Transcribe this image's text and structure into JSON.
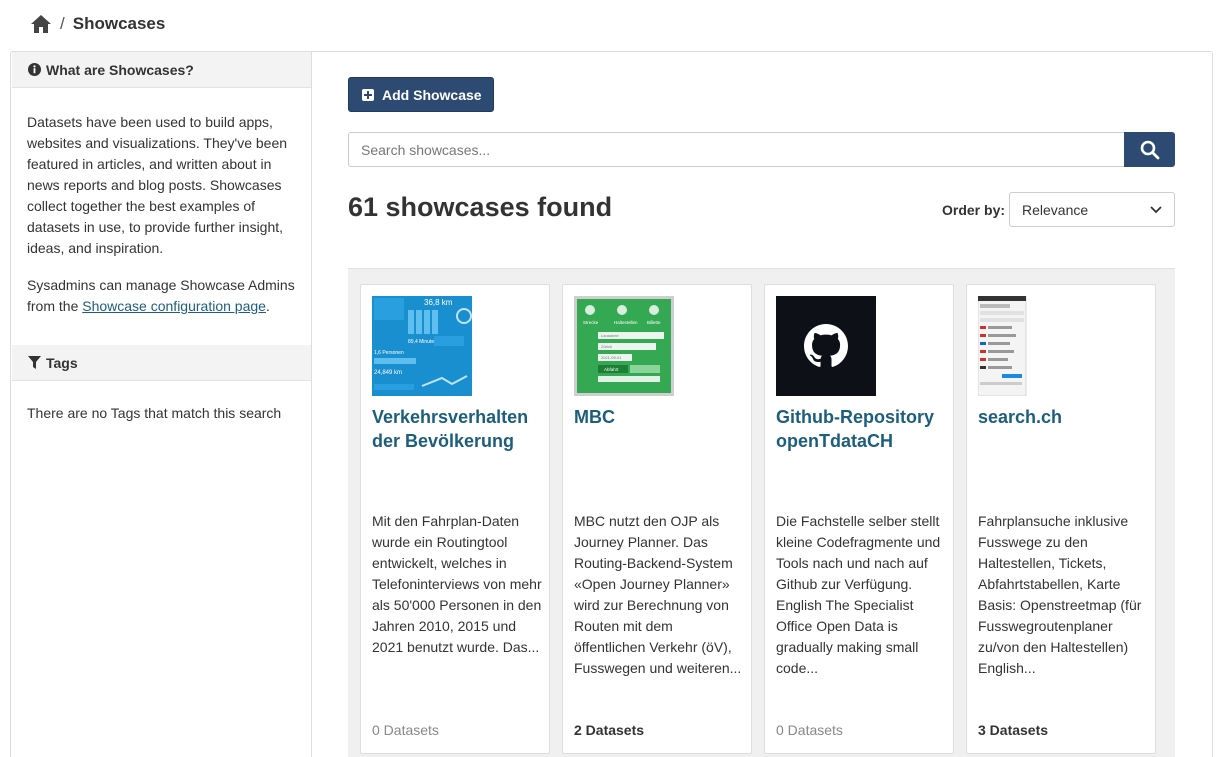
{
  "breadcrumb": {
    "home_icon": "home-icon",
    "separator": "/",
    "current": "Showcases"
  },
  "sidebar": {
    "about_heading": "What are Showcases?",
    "about_p1": "Datasets have been used to build apps, websites and visualizations. They've been featured in articles, and written about in news reports and blog posts. Showcases collect together the best examples of datasets in use, to provide further insight, ideas, and inspiration.",
    "about_p2_prefix": "Sysadmins can manage Showcase Admins from the ",
    "about_p2_link": "Showcase configuration page",
    "about_p2_suffix": ".",
    "tags_heading": "Tags",
    "tags_empty": "There are no Tags that match this search"
  },
  "toolbar": {
    "add_label": "Add Showcase"
  },
  "search": {
    "placeholder": "Search showcases...",
    "value": ""
  },
  "results": {
    "count_text": "61 showcases found",
    "order_label": "Order by:",
    "order_value": "Relevance"
  },
  "colors": {
    "primary": "#2c4a72",
    "link": "#1c5e7d"
  },
  "cards": [
    {
      "title": "Verkehrsverhalten der Bevölkerung",
      "description": "Mit den Fahrplan-Daten wurde ein Routingtool entwickelt, welches in Telefoninterviews von mehr als 50'000 Personen in den Jahren 2010, 2015 und 2021 benutzt wurde. Das...",
      "datasets": "0 Datasets",
      "thumb_texts": {
        "km": "36,8 km",
        "minutes": "89,4 Minuten",
        "persons": "1,6 Personen",
        "km2": "24,849 km"
      }
    },
    {
      "title": "MBC",
      "description": "MBC nutzt den OJP als Journey Planner. Das Routing-Backend-System «Open Journey Planner» wird zur Berechnung von Routen mit dem öffentlichen Verkehr (öV), Fusswegen und weiteren...",
      "datasets": "2 Datasets",
      "thumb_texts": {
        "tab1": "Strecke",
        "tab2": "Haltestellen",
        "tab3": "Billette",
        "from": "Lausanne",
        "to": "Zürich",
        "date": "2021-09-01",
        "btn": "Abfahrt"
      }
    },
    {
      "title": "Github-Repository openTdataCH",
      "description": "Die Fachstelle selber stellt kleine Codefragmente und Tools nach und nach auf Github zur Verfügung. English The Specialist Office Open Data is gradually making small code...",
      "datasets": "0 Datasets",
      "thumb_icon": "github-icon"
    },
    {
      "title": "search.ch",
      "description": "Fahrplansuche inklusive Fusswege zu den Haltestellen, Tickets, Abfahrtstabellen, Karte Basis: Openstreetmap (für Fusswegroutenplaner zu/von den Haltestellen) English...",
      "datasets": "3 Datasets",
      "thumb_icon": "mobile-screenshot"
    }
  ]
}
